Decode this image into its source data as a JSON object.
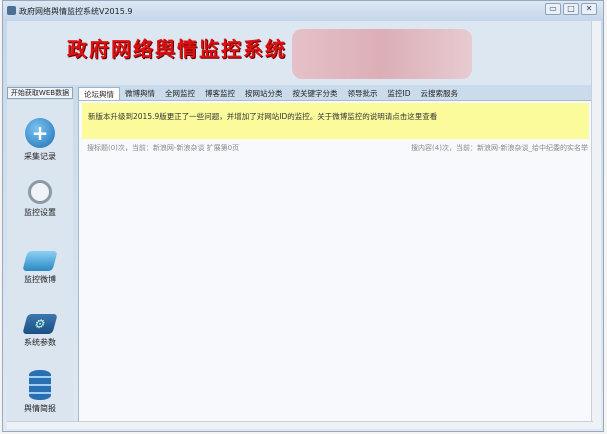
{
  "window": {
    "title": "政府网络舆情监控系统V2015.9",
    "min": "▭",
    "max": "□",
    "close": "✕"
  },
  "header": {
    "logo_text": "政府网络舆情监控系统"
  },
  "toolbar": {
    "start_label": "开始获取WEB数据"
  },
  "tabs": [
    {
      "label": "论坛舆情"
    },
    {
      "label": "微博舆情"
    },
    {
      "label": "全网监控"
    },
    {
      "label": "博客监控"
    },
    {
      "label": "按网站分类"
    },
    {
      "label": "按关键字分类"
    },
    {
      "label": "领导批示"
    },
    {
      "label": "监控ID"
    },
    {
      "label": "云搜索服务"
    }
  ],
  "sidebar": {
    "items": [
      {
        "label": "采集记录",
        "icon": "plus-icon"
      },
      {
        "label": "监控设置",
        "icon": "magnifier-icon"
      },
      {
        "label": "监控微博",
        "icon": "mail-icon"
      },
      {
        "label": "系统参数",
        "icon": "gear-icon"
      },
      {
        "label": "舆情简报",
        "icon": "database-icon"
      }
    ]
  },
  "main": {
    "notice": "新版本升级到2015.9版更正了一些问题，并增加了对网站ID的监控。关于微博监控的说明请点击这里查看",
    "status_left": "搜标题(0)次，当前：新浪网-新浪杂谈 扩展第0页",
    "status_right": "搜内容(4)次，当前：新浪网-新浪杂谈_给中纪委的实名举"
  }
}
